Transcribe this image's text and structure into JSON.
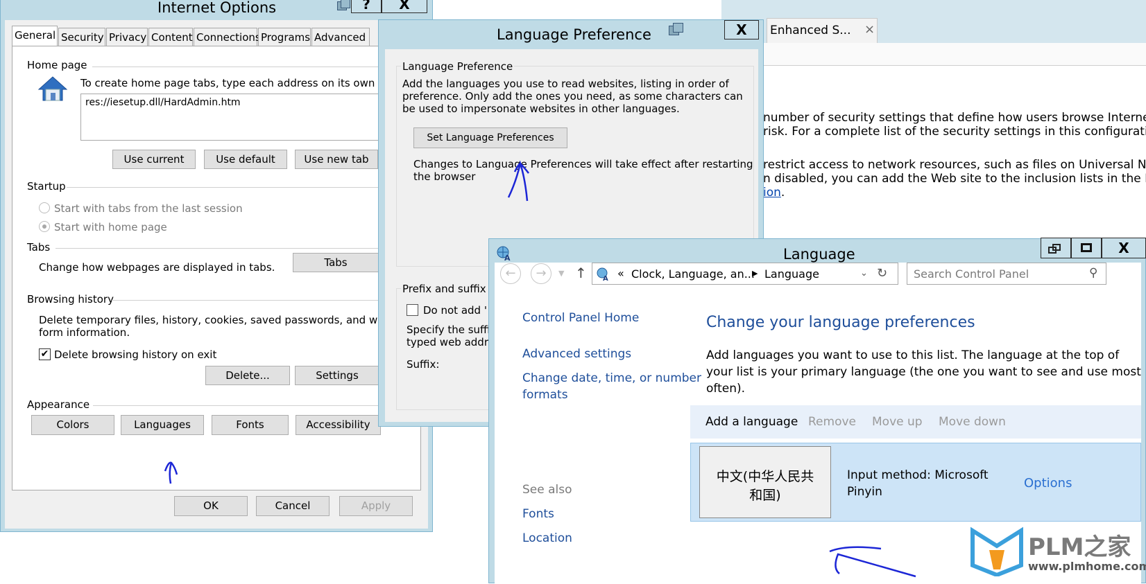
{
  "browser_tab": {
    "label": "Enhanced S...",
    "close": "×"
  },
  "background_doc": {
    "line1": "number of security settings that define how users browse Interne",
    "line2": " risk. For a complete list of the security settings in this configurati",
    "line3": "restrict access to network resources, such as files on Universal Na",
    "line4": "n disabled, you can add the Web site to the inclusion lists in the L",
    "line5_link": "ion",
    "line5_rest": "."
  },
  "internet_options": {
    "title": "Internet Options",
    "help": "?",
    "close": "X",
    "tabs": [
      "General",
      "Security",
      "Privacy",
      "Content",
      "Connections",
      "Programs",
      "Advanced"
    ],
    "home_page": {
      "heading": "Home page",
      "description": "To create home page tabs, type each address on its own line",
      "url": "res://iesetup.dll/HardAdmin.htm",
      "use_current": "Use current",
      "use_default": "Use default",
      "use_new_tab": "Use new tab"
    },
    "startup": {
      "heading": "Startup",
      "opt_last_session": "Start with tabs from the last session",
      "opt_home_page": "Start with home page"
    },
    "tabs_section": {
      "heading": "Tabs",
      "description": "Change how webpages are displayed in tabs.",
      "button": "Tabs"
    },
    "browsing_history": {
      "heading": "Browsing history",
      "description_line1": "Delete temporary files, history, cookies, saved passwords, and web",
      "description_line2": "form information.",
      "delete_on_exit": "Delete browsing history on exit",
      "delete_button": "Delete...",
      "settings_button": "Settings"
    },
    "appearance": {
      "heading": "Appearance",
      "colors": "Colors",
      "languages": "Languages",
      "fonts": "Fonts",
      "accessibility": "Accessibility"
    },
    "footer": {
      "ok": "OK",
      "cancel": "Cancel",
      "apply": "Apply"
    }
  },
  "language_preference": {
    "title": "Language Preference",
    "close": "X",
    "group_heading": "Language Preference",
    "description_line1": "Add the languages you use to read websites, listing in order of",
    "description_line2": "preference. Only add the ones you need, as some characters can",
    "description_line3": "be used to impersonate websites in other languages.",
    "set_button": "Set Language Preferences",
    "note_line1": "Changes to Language Preferences will take effect after restarting",
    "note_line2": "the browser",
    "prefix_heading": "Prefix and suffix o",
    "do_not_add": "Do not add '",
    "specify_line1": "Specify the suffi",
    "specify_line2": "typed web addre",
    "suffix_label": "Suffix:"
  },
  "language_window": {
    "title": "Language",
    "close": "X",
    "address": {
      "chevrons": "«",
      "crumb1": "Clock, Language, an...",
      "crumb2": "Language"
    },
    "search_placeholder": "Search Control Panel",
    "sidebar": {
      "home": "Control Panel Home",
      "advanced": "Advanced settings",
      "change_date_line1": "Change date, time, or number",
      "change_date_line2": "formats",
      "see_also": "See also",
      "fonts": "Fonts",
      "location": "Location"
    },
    "main": {
      "heading": "Change your language preferences",
      "desc_line1": "Add languages you want to use to this list. The language at the top of",
      "desc_line2": "your list is your primary language (the one you want to see and use most",
      "desc_line3": "often).",
      "toolbar": {
        "add": "Add a language",
        "remove": "Remove",
        "move_up": "Move up",
        "move_down": "Move down"
      },
      "language_item": {
        "name_line1": "中文(中华人民共",
        "name_line2": "和国)",
        "input_line1": "Input method: Microsoft",
        "input_line2": "Pinyin",
        "options": "Options"
      }
    }
  },
  "watermark": {
    "brand": "PLM之家",
    "url": "www.plmhome.com"
  }
}
